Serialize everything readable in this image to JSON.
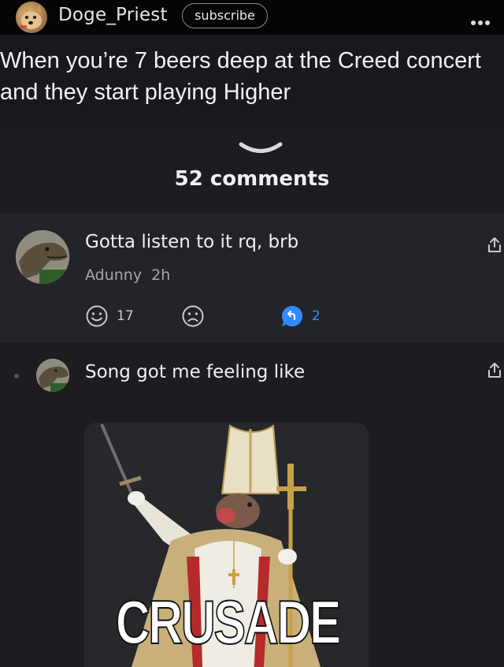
{
  "post": {
    "username": "Doge_Priest",
    "subscribe_label": "subscribe",
    "caption": "When you’re 7 beers deep at the Creed concert\nand they start playing Higher"
  },
  "comments_header": {
    "count_label": "52 comments"
  },
  "comments": [
    {
      "text": "Gotta listen to it rq, brb",
      "author": "Adunny",
      "time": "2h",
      "like_count": "17",
      "reply_count": "2"
    },
    {
      "text": "Song got me feeling like",
      "image_caption": "CRUSADE"
    }
  ],
  "colors": {
    "accent_blue": "#2f8cff",
    "background": "#1c1c21",
    "header": "#050507"
  },
  "icons": [
    "doge-avatar-icon",
    "more-dots-icon",
    "chevron-down-icon",
    "smile-icon",
    "frown-icon",
    "reply-icon",
    "share-icon"
  ]
}
